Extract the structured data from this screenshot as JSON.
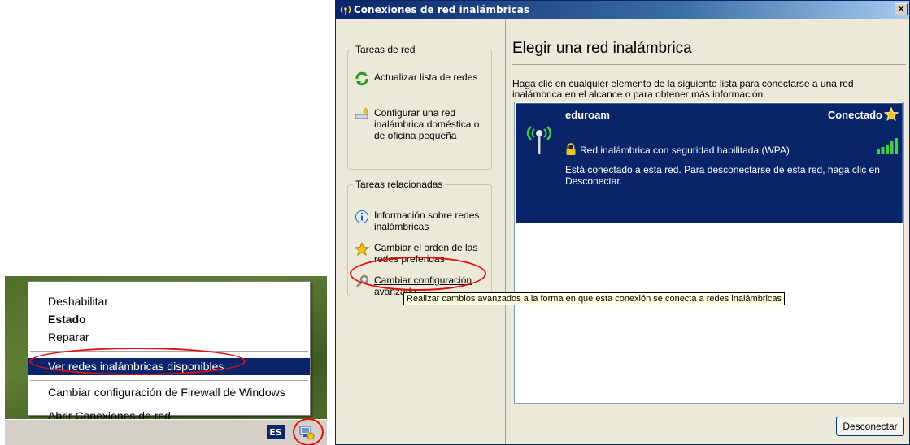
{
  "context_menu": {
    "items": [
      {
        "label": "Deshabilitar"
      },
      {
        "label": "Estado"
      },
      {
        "label": "Reparar"
      },
      {
        "label": "Ver redes inalámbricas disponibles"
      },
      {
        "label": "Cambiar configuración de Firewall de Windows"
      },
      {
        "label": "Abrir Conexiones de red"
      }
    ]
  },
  "taskbar": {
    "language": "ES"
  },
  "window": {
    "title": "Conexiones de red inalámbricas",
    "close_label": "×"
  },
  "sidebar": {
    "network_tasks": {
      "title": "Tareas de red",
      "items": [
        {
          "label": "Actualizar lista de redes",
          "icon": "refresh-icon"
        },
        {
          "label": "Configurar una red inalámbrica doméstica o de oficina pequeña",
          "icon": "wizard-icon"
        }
      ]
    },
    "related_tasks": {
      "title": "Tareas relacionadas",
      "items": [
        {
          "label": "Información sobre redes inalámbricas",
          "icon": "info-icon"
        },
        {
          "label": "Cambiar el orden de las redes preferidas",
          "icon": "star-icon"
        },
        {
          "label": "Cambiar configuración avanzada",
          "icon": "wrench-icon"
        }
      ]
    }
  },
  "main": {
    "heading": "Elegir una red inalámbrica",
    "instructions": "Haga clic en cualquier elemento de la siguiente lista para conectarse a una red inalámbrica en el alcance o para obtener más información.",
    "network": {
      "ssid": "eduroam",
      "status": "Conectado",
      "security": "Red inalámbrica con seguridad habilitada (WPA)",
      "description": "Está conectado a esta red. Para desconectarse de esta red, haga clic en Desconectar.",
      "signal_bars": 5
    },
    "disconnect_button": "Desconectar"
  },
  "tooltip": "Realizar cambios avanzados a la forma en que esta conexión se conecta a redes inalámbricas",
  "colors": {
    "selection": "#0a246a",
    "highlight_ring": "#e01010",
    "window_bg": "#ece9d8"
  }
}
